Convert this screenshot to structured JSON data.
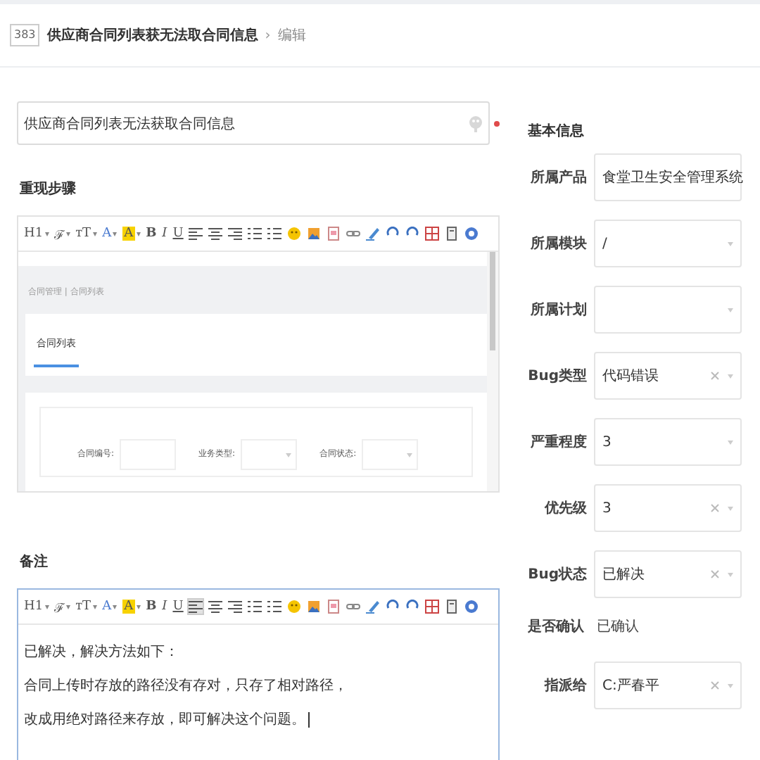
{
  "header": {
    "id": "383",
    "title": "供应商合同列表获无法取合同信息",
    "separator": "›",
    "action": "编辑"
  },
  "title_field": {
    "value": "供应商合同列表无法获取合同信息",
    "required": true
  },
  "steps": {
    "label": "重现步骤",
    "toolbar": [
      {
        "kind": "glyph",
        "label": "H1",
        "dropdown": true,
        "active": false
      },
      {
        "kind": "glyph",
        "label": "ℱ",
        "dropdown": true,
        "active": false
      },
      {
        "kind": "glyph",
        "label": "тT",
        "dropdown": true,
        "active": false
      },
      {
        "kind": "color",
        "label": "A",
        "dropdown": true,
        "active": false
      },
      {
        "kind": "highlight",
        "label": "A",
        "dropdown": true,
        "active": false
      },
      {
        "kind": "bold",
        "label": "B",
        "dropdown": false,
        "active": false
      },
      {
        "kind": "italic",
        "label": "I",
        "dropdown": false,
        "active": false
      },
      {
        "kind": "underline",
        "label": "U",
        "dropdown": false,
        "active": false
      },
      {
        "kind": "align-left",
        "active": false
      },
      {
        "kind": "align-center",
        "active": false
      },
      {
        "kind": "align-right",
        "active": false
      },
      {
        "kind": "ordered-list",
        "active": false
      },
      {
        "kind": "bullet-list",
        "active": false
      },
      {
        "kind": "emoji",
        "active": false
      },
      {
        "kind": "image",
        "active": false
      },
      {
        "kind": "file",
        "active": false
      },
      {
        "kind": "link",
        "active": false
      },
      {
        "kind": "eraser",
        "active": false
      },
      {
        "kind": "undo",
        "active": false
      },
      {
        "kind": "redo",
        "active": false
      },
      {
        "kind": "table",
        "active": false
      },
      {
        "kind": "code",
        "active": false
      },
      {
        "kind": "info",
        "active": false
      }
    ],
    "embedded": {
      "breadcrumb": "合同管理 | 合同列表",
      "tabs": [
        {
          "label": "合同列表",
          "selected": true
        }
      ],
      "filters": [
        {
          "label": "合同编号:",
          "kind": "input"
        },
        {
          "label": "业务类型:",
          "kind": "select"
        },
        {
          "label": "合同状态:",
          "kind": "select"
        }
      ]
    }
  },
  "notes": {
    "label": "备注",
    "toolbar": [
      {
        "kind": "glyph",
        "label": "H1",
        "dropdown": true,
        "active": false
      },
      {
        "kind": "glyph",
        "label": "ℱ",
        "dropdown": true,
        "active": false
      },
      {
        "kind": "glyph",
        "label": "тT",
        "dropdown": true,
        "active": false
      },
      {
        "kind": "color",
        "label": "A",
        "dropdown": true,
        "active": false
      },
      {
        "kind": "highlight",
        "label": "A",
        "dropdown": true,
        "active": false
      },
      {
        "kind": "bold",
        "label": "B",
        "dropdown": false,
        "active": false
      },
      {
        "kind": "italic",
        "label": "I",
        "dropdown": false,
        "active": false
      },
      {
        "kind": "underline",
        "label": "U",
        "dropdown": false,
        "active": false
      },
      {
        "kind": "align-left",
        "active": true
      },
      {
        "kind": "align-center",
        "active": false
      },
      {
        "kind": "align-right",
        "active": false
      },
      {
        "kind": "ordered-list",
        "active": false
      },
      {
        "kind": "bullet-list",
        "active": false
      },
      {
        "kind": "emoji",
        "active": false
      },
      {
        "kind": "image",
        "active": false
      },
      {
        "kind": "file",
        "active": false
      },
      {
        "kind": "link",
        "active": false
      },
      {
        "kind": "eraser",
        "active": false
      },
      {
        "kind": "undo",
        "active": false
      },
      {
        "kind": "redo",
        "active": false
      },
      {
        "kind": "table",
        "active": false
      },
      {
        "kind": "code",
        "active": false
      },
      {
        "kind": "info",
        "active": false
      }
    ],
    "lines": [
      "已解决，解决方法如下：",
      "合同上传时存放的路径没有存对，只存了相对路径，",
      "改成用绝对路径来存放，即可解决这个问题。"
    ]
  },
  "basic_info": {
    "title": "基本信息",
    "fields": [
      {
        "kind": "select",
        "label": "所属产品",
        "value": "食堂卫生安全管理系统",
        "clearable": false
      },
      {
        "kind": "select",
        "label": "所属模块",
        "value": "/",
        "clearable": false
      },
      {
        "kind": "select",
        "label": "所属计划",
        "clearable": false
      },
      {
        "kind": "select",
        "label": "Bug类型",
        "value": "代码错误",
        "clearable": true
      },
      {
        "kind": "select",
        "label": "严重程度",
        "value": "3",
        "clearable": false
      },
      {
        "kind": "select",
        "label": "优先级",
        "value": "3",
        "clearable": true
      },
      {
        "kind": "select",
        "label": "Bug状态",
        "value": "已解决",
        "clearable": true
      },
      {
        "kind": "text",
        "label": "是否确认",
        "value": "已确认"
      },
      {
        "kind": "select",
        "label": "指派给",
        "value": "C:严春平",
        "clearable": true
      }
    ]
  }
}
